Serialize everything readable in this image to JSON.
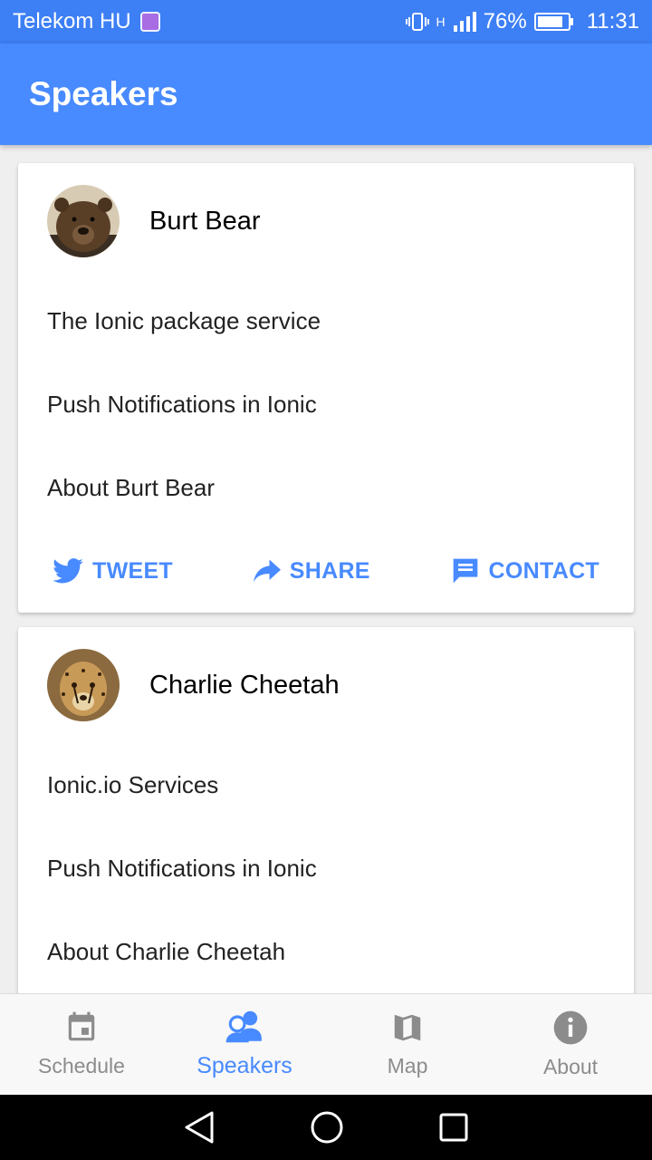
{
  "status_bar": {
    "carrier": "Telekom HU",
    "network": "H",
    "battery": "76%",
    "time": "11:31"
  },
  "toolbar": {
    "title": "Speakers"
  },
  "speakers": [
    {
      "name": "Burt Bear",
      "avatar_icon": "bear-photo",
      "talks": [
        "The Ionic package service",
        "Push Notifications in Ionic"
      ],
      "about": "About Burt Bear",
      "actions": {
        "tweet": "TWEET",
        "share": "SHARE",
        "contact": "CONTACT"
      }
    },
    {
      "name": "Charlie Cheetah",
      "avatar_icon": "cheetah-photo",
      "talks": [
        "Ionic.io Services",
        "Push Notifications in Ionic"
      ],
      "about": "About Charlie Cheetah"
    }
  ],
  "tabs": [
    {
      "label": "Schedule",
      "icon": "calendar-icon",
      "active": false
    },
    {
      "label": "Speakers",
      "icon": "contacts-icon",
      "active": true
    },
    {
      "label": "Map",
      "icon": "map-icon",
      "active": false
    },
    {
      "label": "About",
      "icon": "info-icon",
      "active": false
    }
  ],
  "colors": {
    "primary": "#488aff",
    "status_bar": "#3d7ff5",
    "tab_inactive": "#8c8c8c"
  }
}
